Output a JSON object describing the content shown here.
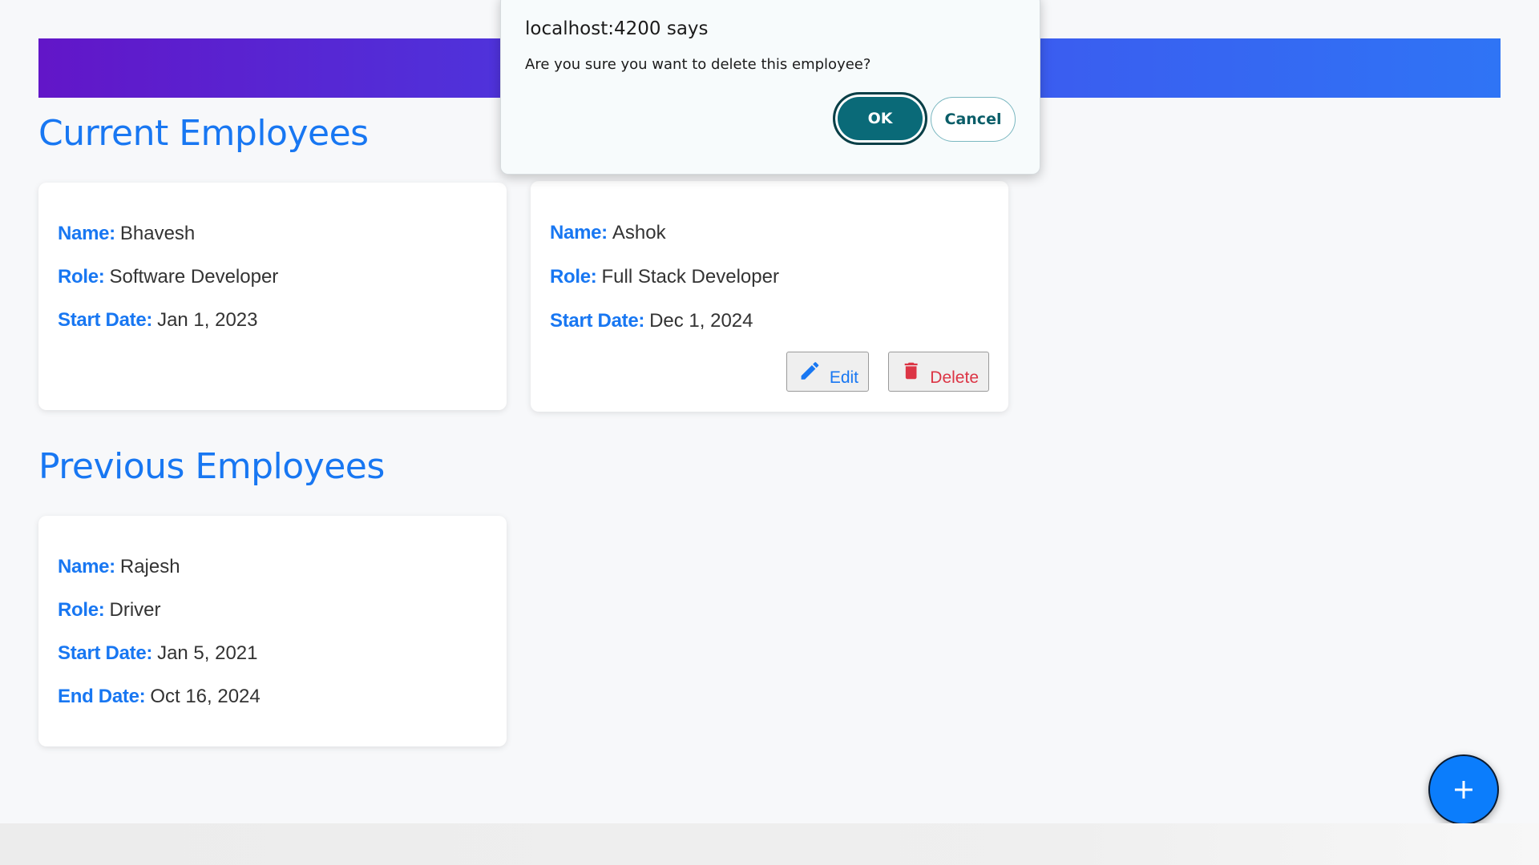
{
  "dialog": {
    "title": "localhost:4200 says",
    "message": "Are you sure you want to delete this employee?",
    "ok_label": "OK",
    "cancel_label": "Cancel"
  },
  "sections": {
    "current_title": "Current Employees",
    "previous_title": "Previous Employees"
  },
  "labels": {
    "name": "Name:",
    "role": "Role:",
    "start_date": "Start Date:",
    "end_date": "End Date:"
  },
  "current_employees": [
    {
      "name": "Bhavesh",
      "role": "Software Developer",
      "start_date": "Jan 1, 2023"
    },
    {
      "name": "Ashok",
      "role": "Full Stack Developer",
      "start_date": "Dec 1, 2024"
    }
  ],
  "previous_employees": [
    {
      "name": "Rajesh",
      "role": "Driver",
      "start_date": "Jan 5, 2021",
      "end_date": "Oct 16, 2024"
    }
  ],
  "actions": {
    "edit_label": "Edit",
    "delete_label": "Delete",
    "edit_icon": "pencil-icon",
    "delete_icon": "trash-icon",
    "add_icon": "plus-icon"
  },
  "colors": {
    "accent": "#1877f2",
    "delete": "#dc3545",
    "dialog_ok": "#0a6a78",
    "header_gradient_start": "#6216c8",
    "header_gradient_end": "#2f74f5"
  }
}
